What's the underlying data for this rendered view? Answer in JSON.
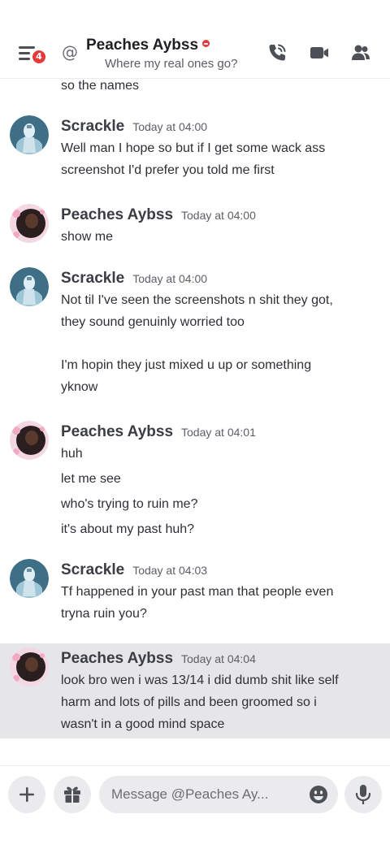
{
  "header": {
    "notification_count": "4",
    "title": "Peaches Aybss",
    "subtitle": "Where my real ones go?",
    "at_symbol": "@"
  },
  "messages": [
    {
      "lines": [
        "so the names"
      ]
    },
    {
      "author": "Scrackle",
      "time": "Today at 04:00",
      "lines": [
        "Well man I hope so but if I get some wack ass",
        "screenshot I'd prefer you told me first"
      ]
    },
    {
      "author": "Peaches Aybss",
      "time": "Today at 04:00",
      "lines": [
        "show me"
      ]
    },
    {
      "author": "Scrackle",
      "time": "Today at 04:00",
      "lines": [
        "Not til I've seen the screenshots n shit they got,",
        "they sound genuinly worried too",
        "I'm hopin they just mixed u up or something",
        "yknow"
      ]
    },
    {
      "author": "Peaches Aybss",
      "time": "Today at 04:01",
      "lines": [
        "huh",
        "let me see",
        "who's trying to ruin me?",
        "it's about my past huh?"
      ]
    },
    {
      "author": "Scrackle",
      "time": "Today at 04:03",
      "lines": [
        "Tf happened in your past man that people even",
        "tryna ruin you?"
      ]
    },
    {
      "author": "Peaches Aybss",
      "time": "Today at 04:04",
      "lines": [
        "look bro wen i was 13/14 i did dumb shit like self",
        "harm and lots of pills and been groomed so i",
        "wasn't in a good mind space"
      ]
    }
  ],
  "composer": {
    "placeholder": "Message @Peaches Ay..."
  },
  "icons": {
    "menu": "hamburger-menu-icon",
    "call": "phone-call-icon",
    "video": "video-camera-icon",
    "members": "member-list-icon",
    "plus": "plus-icon",
    "gift": "gift-icon",
    "emoji": "emoji-icon",
    "mic": "microphone-icon"
  },
  "colors": {
    "badge": "#e23b3b",
    "highlight": "#e6e6e8",
    "icon": "#4e5058"
  }
}
